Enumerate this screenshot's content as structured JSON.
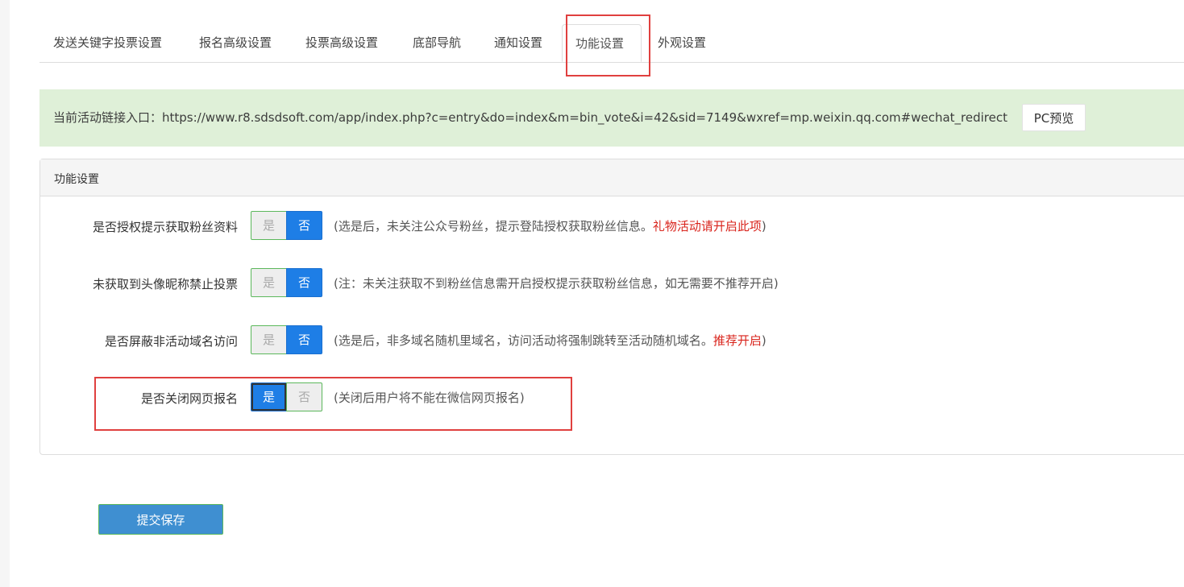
{
  "tabs": [
    {
      "label": "发送关键字投票设置"
    },
    {
      "label": "报名高级设置"
    },
    {
      "label": "投票高级设置"
    },
    {
      "label": "底部导航"
    },
    {
      "label": "通知设置"
    },
    {
      "label": "功能设置",
      "active": true
    },
    {
      "label": "外观设置"
    }
  ],
  "link_bar": {
    "text": "当前活动链接入口：https://www.r8.sdsdsoft.com/app/index.php?c=entry&do=index&m=bin_vote&i=42&sid=7149&wxref=mp.weixin.qq.com#wechat_redirect",
    "preview_label": "PC预览"
  },
  "panel": {
    "title": "功能设置",
    "rows": [
      {
        "label": "是否授权提示获取粉丝资料",
        "yes": "是",
        "no": "否",
        "selected": "否",
        "help_before": "(选是后，未关注公众号粉丝，提示登陆授权获取粉丝信息。",
        "help_red": "礼物活动请开启此项",
        "help_after": ")"
      },
      {
        "label": "未获取到头像昵称禁止投票",
        "yes": "是",
        "no": "否",
        "selected": "否",
        "help_before": "(注：未关注获取不到粉丝信息需开启授权提示获取粉丝信息，如无需要不推荐开启)",
        "help_red": "",
        "help_after": ""
      },
      {
        "label": "是否屏蔽非活动域名访问",
        "yes": "是",
        "no": "否",
        "selected": "否",
        "help_before": "(选是后，非多域名随机里域名，访问活动将强制跳转至活动随机域名。",
        "help_red": "推荐开启",
        "help_after": ")"
      },
      {
        "label": "是否关闭网页报名",
        "yes": "是",
        "no": "否",
        "selected": "是",
        "help_before": "(关闭后用户将不能在微信网页报名)",
        "help_red": "",
        "help_after": ""
      }
    ]
  },
  "submit_label": "提交保存",
  "colors": {
    "accent_blue": "#1e7ee6",
    "success_border": "#5cb85c",
    "highlight_red": "#e0403f",
    "link_bar_bg": "#dff0d8",
    "help_red": "#d9241c"
  }
}
